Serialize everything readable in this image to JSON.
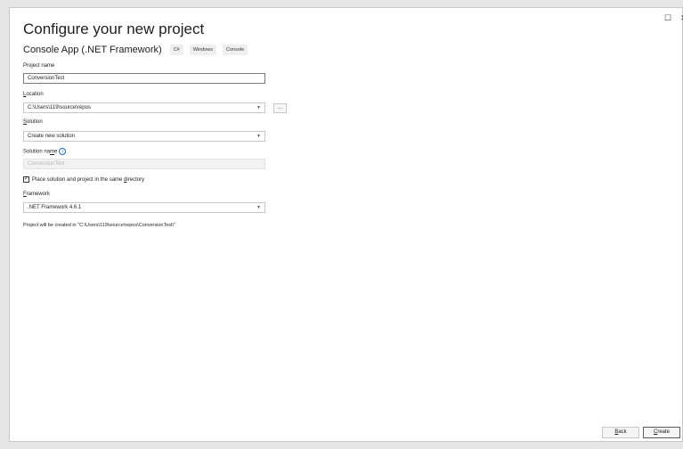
{
  "window": {
    "maximize_glyph": "☐",
    "close_glyph": "✕"
  },
  "header": {
    "title": "Configure your new project",
    "subtitle": "Console App (.NET Framework)",
    "tags": [
      "C#",
      "Windows",
      "Console"
    ]
  },
  "form": {
    "project_name": {
      "label": "Project name",
      "value": "ConversionTest"
    },
    "location": {
      "label_u": "L",
      "label_rest": "ocation",
      "value": "C:\\Users\\119\\source\\repos",
      "browse_label": "..."
    },
    "solution": {
      "label_u": "S",
      "label_rest": "olution",
      "value": "Create new solution"
    },
    "solution_name": {
      "label_pre": "Solution na",
      "label_u": "m",
      "label_post": "e",
      "value": "ConversionTest",
      "info_glyph": "i"
    },
    "same_directory": {
      "checked_glyph": "✓",
      "label_pre": "Place solution and project in the same ",
      "label_u": "d",
      "label_post": "irectory"
    },
    "framework": {
      "label_u": "F",
      "label_rest": "ramework",
      "value": ".NET Framework 4.6.1"
    }
  },
  "note": "Project will be created in \"C:\\Users\\119\\source\\repos\\ConversionTest\\\"",
  "footer": {
    "back_u": "B",
    "back_rest": "ack",
    "create_u": "C",
    "create_rest": "reate"
  },
  "icons": {
    "dropdown": "chevron-down-icon",
    "info": "info-icon",
    "check": "checkmark-icon"
  },
  "colors": {
    "accent": "#1a6fc9",
    "border": "#c8c8c8",
    "background": "#ffffff"
  }
}
